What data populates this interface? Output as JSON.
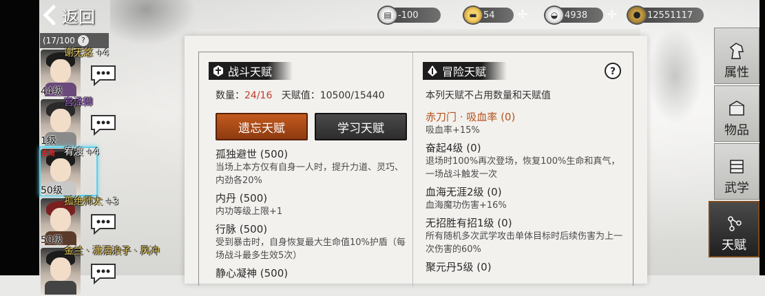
{
  "topbar": {
    "back_label": "返回",
    "resources": [
      {
        "name": "supply",
        "icon": "cart-icon",
        "value": "-100"
      },
      {
        "name": "gold",
        "icon": "gold-bar-icon",
        "value": "54"
      },
      {
        "name": "silver",
        "icon": "silver-ingot-icon",
        "value": "4938"
      },
      {
        "name": "coin",
        "icon": "copper-coin-icon",
        "value": "12551117"
      }
    ]
  },
  "roster": {
    "count": "(17/100",
    "help": "?",
    "characters": [
      {
        "name": "谢无悠",
        "plus": "+4",
        "level": "44级",
        "color": "#f0d060"
      },
      {
        "name": "宫泽卿",
        "plus": "",
        "level": "1级",
        "color": "#b070e0"
      },
      {
        "name": "宥渡",
        "plus": "+4",
        "level": "50级",
        "tag": "主角",
        "color": "#ffffff"
      },
      {
        "name": "孤绝师太",
        "plus": "+3",
        "level": "50级",
        "color": "#f0d060"
      },
      {
        "name": "金兰 · 潇洒浪子 · 风冲",
        "plus": "",
        "level": "",
        "color": "#f0d060"
      }
    ]
  },
  "battle": {
    "title": "战斗天赋",
    "count_label": "数量：",
    "count_value": "24/16",
    "value_label": "天赋值：10500/15440",
    "forget_btn": "遗忘天赋",
    "learn_btn": "学习天赋",
    "talents": [
      {
        "name": "孤独避世 (500)",
        "desc": "当场上本方仅有自身一人时，提升力道、灵巧、内劲各20%"
      },
      {
        "name": "内丹 (500)",
        "desc": "内功等级上限+1"
      },
      {
        "name": "行脉 (500)",
        "desc": "受到暴击时，自身恢复最大生命值10%护盾（每场战斗最多生效5次）"
      },
      {
        "name": "静心凝神 (500)",
        "desc": ""
      }
    ]
  },
  "adventure": {
    "title": "冒险天赋",
    "intro": "本列天赋不占用数量和天赋值",
    "talents": [
      {
        "name": "赤刀门 · 吸血率 (0)",
        "desc": "吸血率+15%",
        "highlight": true
      },
      {
        "name": "奋起4级 (0)",
        "desc": "退场时100%再次登场，恢复100%生命和真气，一场战斗触发一次",
        "highlight": false
      },
      {
        "name": "血海无涯2级 (0)",
        "desc": "血海魔功伤害+16%",
        "highlight": false
      },
      {
        "name": "无招胜有招1级 (0)",
        "desc": "所有随机多次武学攻击单体目标时后续伤害为上一次伤害的60%",
        "highlight": false
      },
      {
        "name": "聚元丹5级 (0)",
        "desc": "",
        "highlight": false
      }
    ]
  },
  "side_tabs": [
    {
      "label": "属性",
      "icon": "horse-head-icon",
      "active": false
    },
    {
      "label": "物品",
      "icon": "treasure-box-icon",
      "active": false
    },
    {
      "label": "武学",
      "icon": "scroll-book-icon",
      "active": false
    },
    {
      "label": "天赋",
      "icon": "talent-tree-icon",
      "active": true
    }
  ]
}
